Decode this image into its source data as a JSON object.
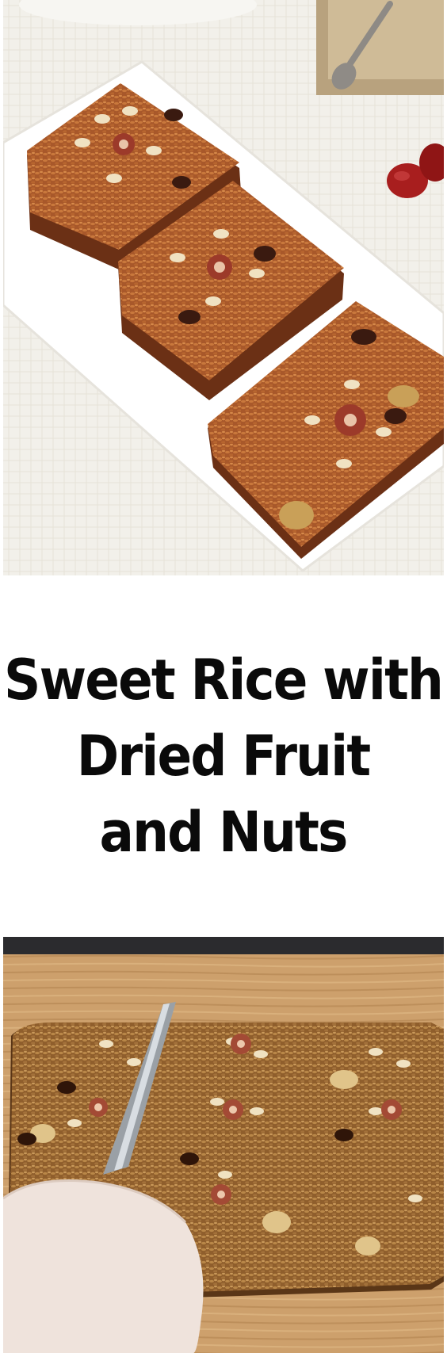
{
  "title": {
    "line1": "Sweet Rice with",
    "line2": "Dried Fruit",
    "line3": "and Nuts"
  }
}
